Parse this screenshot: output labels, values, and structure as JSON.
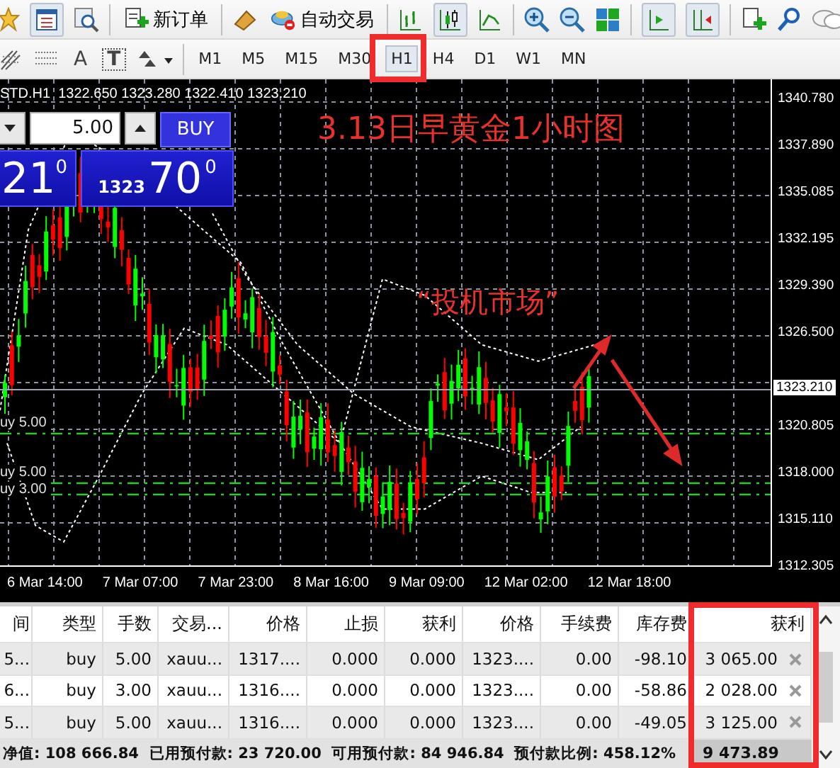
{
  "toolbar": {
    "new_order_label": "新订单",
    "auto_trading_label": "自动交易"
  },
  "drawing_tools": {
    "text_tool_label": "A",
    "label_tool_label": "T"
  },
  "timeframes": [
    {
      "label": "M1",
      "selected": false
    },
    {
      "label": "M5",
      "selected": false
    },
    {
      "label": "M15",
      "selected": false
    },
    {
      "label": "M30",
      "selected": false
    },
    {
      "label": "H1",
      "selected": true
    },
    {
      "label": "H4",
      "selected": false
    },
    {
      "label": "D1",
      "selected": false
    },
    {
      "label": "W1",
      "selected": false
    },
    {
      "label": "MN",
      "selected": false
    }
  ],
  "chart": {
    "symbol_line": "STD.H1  1322.650 1323.280 1322.410 1323.210",
    "trade_panel": {
      "lot": "5.00",
      "buy_label": "BUY",
      "sell_price_tail": "21",
      "sell_price_sup": "0",
      "buy_price_head": "1323",
      "buy_price_tail": "70",
      "buy_price_sup": "0"
    },
    "title_annotation": "3.13日早黄金1小时图",
    "note_annotation": "“投机市场”",
    "price_labels": [
      "1340.780",
      "1337.890",
      "1335.085",
      "1332.195",
      "1329.390",
      "1326.500",
      "1320.805",
      "1318.000",
      "1315.110",
      "1312.305"
    ],
    "current_price": "1323.210",
    "order_labels": [
      "uy 5.00",
      "uy 5.00",
      "uy 3.00"
    ],
    "time_labels": [
      "6 Mar 14:00",
      "7 Mar 07:00",
      "7 Mar 23:00",
      "8 Mar 16:00",
      "9 Mar 09:00",
      "12 Mar 02:00",
      "12 Mar 18:00"
    ]
  },
  "trades": {
    "columns": [
      "间",
      "类型",
      "手数",
      "交易...",
      "价格",
      "止损",
      "获利",
      "价格",
      "手续费",
      "库存费",
      "获利"
    ],
    "rows": [
      [
        "5...",
        "buy",
        "5.00",
        "xauu...",
        "1317....",
        "0.000",
        "0.000",
        "1323....",
        "0.00",
        "-98.10",
        "3 065.00"
      ],
      [
        "6...",
        "buy",
        "3.00",
        "xauu...",
        "1316....",
        "0.000",
        "0.000",
        "1323....",
        "0.00",
        "-58.86",
        "2 028.00"
      ],
      [
        "5...",
        "buy",
        "5.00",
        "xauu...",
        "1316....",
        "0.000",
        "0.000",
        "1323....",
        "0.00",
        "-49.05",
        "3 125.00"
      ]
    ],
    "summary": "净值: 108 666.84  已用预付款: 23 720.00  可用预付款: 84 946.84  预付款比例: 458.12%",
    "total_profit": "9 473.89"
  }
}
